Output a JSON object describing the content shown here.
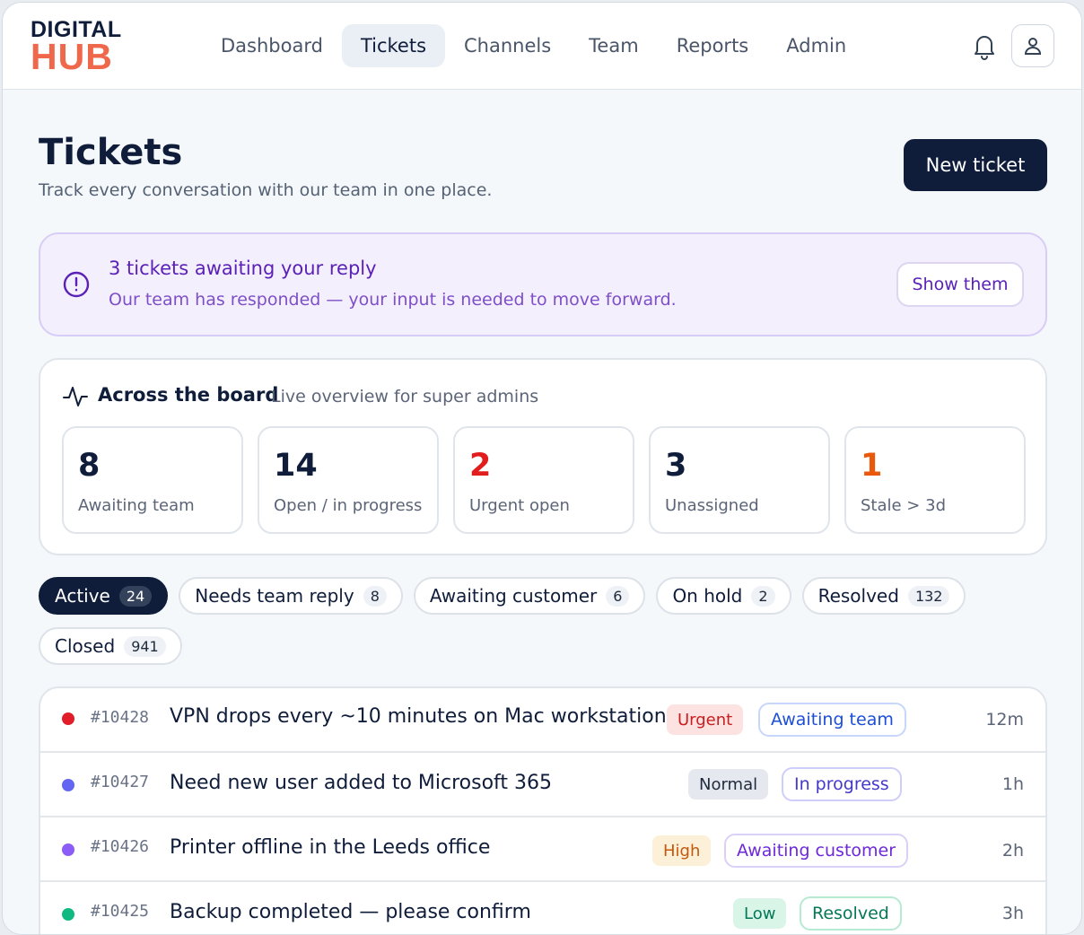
{
  "header": {
    "logo_top": "DIGITAL",
    "logo_bottom": "HUB",
    "nav": [
      "Dashboard",
      "Tickets",
      "Channels",
      "Team",
      "Reports",
      "Admin"
    ],
    "active_nav": "Tickets"
  },
  "page": {
    "title": "Tickets",
    "subtitle": "Track every conversation with our team in one place.",
    "new_button": "New ticket"
  },
  "alert": {
    "title": "3 tickets awaiting your reply",
    "subtitle": "Our team has responded — your input is needed to move forward.",
    "button": "Show them"
  },
  "overview": {
    "title": "Across the board",
    "subtitle": "Live overview for super admins",
    "stats": [
      {
        "value": "8",
        "label": "Awaiting team",
        "color": "#0f1d3a"
      },
      {
        "value": "14",
        "label": "Open / in progress",
        "color": "#0f1d3a"
      },
      {
        "value": "2",
        "label": "Urgent open",
        "color": "#e11d1d"
      },
      {
        "value": "3",
        "label": "Unassigned",
        "color": "#0f1d3a"
      },
      {
        "value": "1",
        "label": "Stale > 3d",
        "color": "#ea580c"
      }
    ]
  },
  "filters": [
    {
      "label": "Active",
      "count": "24",
      "active": true
    },
    {
      "label": "Needs team reply",
      "count": "8"
    },
    {
      "label": "Awaiting customer",
      "count": "6"
    },
    {
      "label": "On hold",
      "count": "2"
    },
    {
      "label": "Resolved",
      "count": "132"
    },
    {
      "label": "Closed",
      "count": "941"
    }
  ],
  "tickets": [
    {
      "id": "#10428",
      "title": "VPN drops every ~10 minutes on Mac workstations",
      "priority": "Urgent",
      "status": "Awaiting team",
      "ago": "12m",
      "dot_color": "#e11d2a"
    },
    {
      "id": "#10427",
      "title": "Need new user added to Microsoft 365",
      "priority": "Normal",
      "status": "In progress",
      "ago": "1h",
      "dot_color": "#6366f1"
    },
    {
      "id": "#10426",
      "title": "Printer offline in the Leeds office",
      "priority": "High",
      "status": "Awaiting customer",
      "ago": "2h",
      "dot_color": "#8b5cf6"
    },
    {
      "id": "#10425",
      "title": "Backup completed — please confirm",
      "priority": "Low",
      "status": "Resolved",
      "ago": "3h",
      "dot_color": "#10b981"
    }
  ],
  "colors": {
    "navy": "#0f1d3a",
    "brand_orange": "#f0684b",
    "alert_purple": "#5b21b6"
  }
}
